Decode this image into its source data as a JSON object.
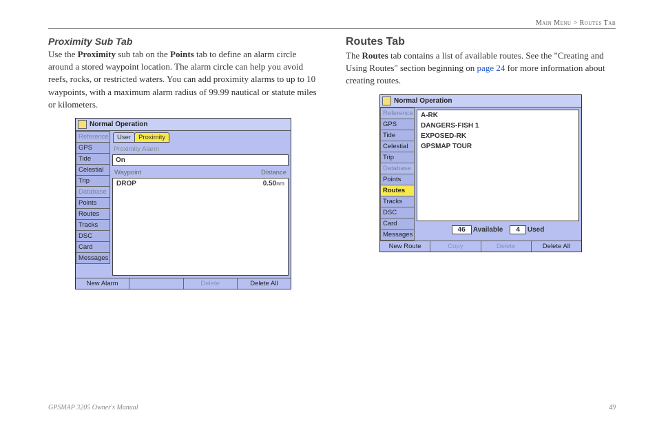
{
  "breadcrumb": {
    "left": "Main Menu",
    "sep": ">",
    "right": "Routes Tab"
  },
  "left_col": {
    "heading": "Proximity Sub Tab",
    "para_parts": {
      "p1": "Use the ",
      "b1": "Proximity",
      "p2": " sub tab on the ",
      "b2": "Points",
      "p3": " tab to define an alarm circle around a stored waypoint location. The alarm circle can help you avoid reefs, rocks, or restricted waters. You can add proximity alarms to up to 10 waypoints, with a maximum alarm radius of 99.99 nautical or statute miles or kilometers."
    },
    "device": {
      "title": "Normal Operation",
      "side_tabs": [
        {
          "label": "Reference",
          "dim": true
        },
        {
          "label": "GPS"
        },
        {
          "label": "Tide"
        },
        {
          "label": "Celestial"
        },
        {
          "label": "Trip"
        },
        {
          "label": "Database",
          "dim": true
        },
        {
          "label": "Points"
        },
        {
          "label": "Routes"
        },
        {
          "label": "Tracks"
        },
        {
          "label": "DSC"
        },
        {
          "label": "Card"
        },
        {
          "label": "Messages"
        }
      ],
      "subtabs": {
        "user": "User",
        "proximity": "Proximity"
      },
      "proximity_alarm_label": "Proximity Alarm",
      "proximity_alarm_value": "On",
      "headers": {
        "waypoint": "Waypoint",
        "distance": "Distance"
      },
      "entry": {
        "name": "DROP",
        "dist": "0.50",
        "unit": "nm"
      },
      "buttons": {
        "new": "New Alarm",
        "delete": "Delete",
        "delete_all": "Delete All"
      }
    }
  },
  "right_col": {
    "heading": "Routes Tab",
    "para_parts": {
      "p1": "The ",
      "b1": "Routes",
      "p2": " tab contains a list of available routes. See the \"Creating and Using Routes\" section beginning on ",
      "link": "page 24",
      "p3": " for more information about creating routes."
    },
    "device": {
      "title": "Normal Operation",
      "side_tabs": [
        {
          "label": "Reference",
          "dim": true
        },
        {
          "label": "GPS"
        },
        {
          "label": "Tide"
        },
        {
          "label": "Celestial"
        },
        {
          "label": "Trip"
        },
        {
          "label": "Database",
          "dim": true
        },
        {
          "label": "Points"
        },
        {
          "label": "Routes",
          "selected": true
        },
        {
          "label": "Tracks"
        },
        {
          "label": "DSC"
        },
        {
          "label": "Card"
        },
        {
          "label": "Messages"
        }
      ],
      "routes": [
        "A-RK",
        "DANGERS-FISH 1",
        "EXPOSED-RK",
        "GPSMAP TOUR"
      ],
      "available_count": "46",
      "available_label": "Available",
      "used_count": "4",
      "used_label": "Used",
      "buttons": {
        "new": "New Route",
        "copy": "Copy",
        "delete": "Delete",
        "delete_all": "Delete All"
      }
    }
  },
  "footer": {
    "left": "GPSMAP 3205 Owner's Manual",
    "right": "49"
  }
}
